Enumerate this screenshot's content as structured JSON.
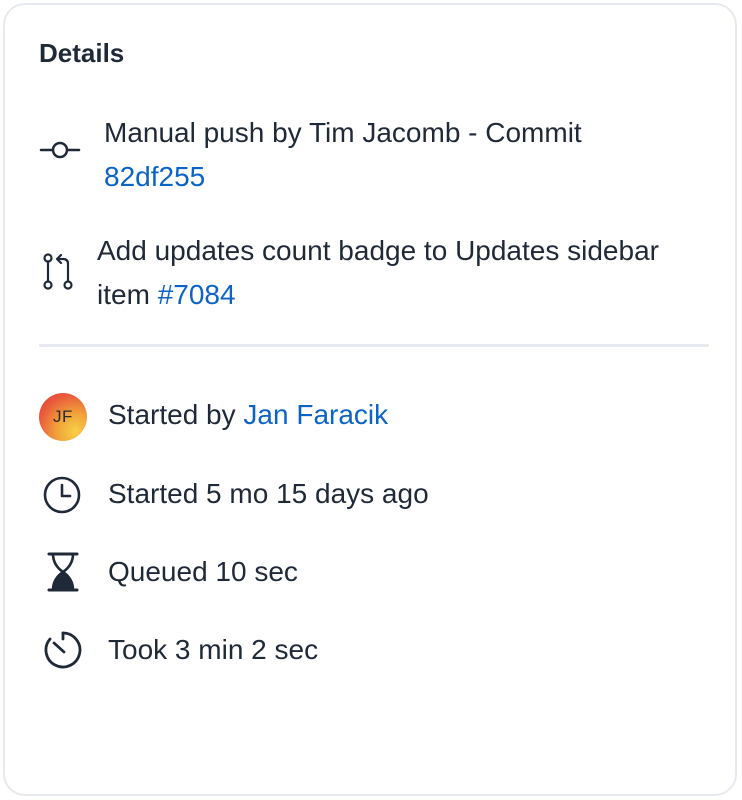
{
  "card": {
    "title": "Details"
  },
  "commit": {
    "icon": "git-commit-icon",
    "prefix": "Manual push by Tim Jacomb - Commit",
    "hash": "82df255"
  },
  "pull_request": {
    "icon": "git-pull-request-icon",
    "title": "Add updates count badge to Updates sidebar item",
    "number": "#7084"
  },
  "started_by": {
    "avatar_initials": "JF",
    "label": "Started by",
    "user": "Jan Faracik"
  },
  "started": {
    "icon": "clock-icon",
    "text": "Started 5 mo 15 days ago"
  },
  "queued": {
    "icon": "hourglass-icon",
    "text": "Queued 10 sec"
  },
  "duration": {
    "icon": "timer-icon",
    "text": "Took 3 min 2 sec"
  },
  "colors": {
    "text": "#1f2937",
    "link": "#0b63c6",
    "border": "#e6e9ef"
  }
}
